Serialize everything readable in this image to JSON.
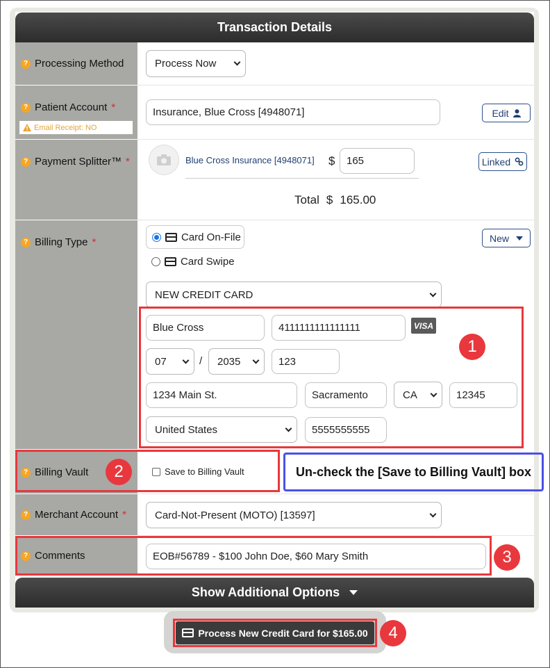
{
  "header": {
    "title": "Transaction Details"
  },
  "fields": {
    "processing_method": {
      "label": "Processing Method",
      "value": "Process Now"
    },
    "patient_account": {
      "label": "Patient Account",
      "value": "Insurance, Blue Cross [4948071]",
      "email_receipt": "Email Receipt: NO",
      "edit_label": "Edit"
    },
    "payment_splitter": {
      "label": "Payment Splitter™",
      "payer": "Blue Cross Insurance [4948071]",
      "currency": "$",
      "amount": "165",
      "linked_label": "Linked",
      "total_label": "Total",
      "total_currency": "$",
      "total_value": "165.00"
    },
    "billing_type": {
      "label": "Billing Type",
      "option_on_file": "Card On-File",
      "option_swipe": "Card Swipe",
      "selected": "Card On-File",
      "new_label": "New",
      "card_select": "NEW CREDIT CARD",
      "card": {
        "name": "Blue Cross",
        "number": "4111111111111111",
        "brand": "VISA",
        "exp_month": "07",
        "exp_separator": "/",
        "exp_year": "2035",
        "cvv": "123",
        "address": "1234 Main St.",
        "city": "Sacramento",
        "state": "CA",
        "zip": "12345",
        "country": "United States",
        "phone": "5555555555"
      }
    },
    "billing_vault": {
      "label": "Billing Vault",
      "checkbox_label": "Save to Billing Vault",
      "checked": false
    },
    "merchant_account": {
      "label": "Merchant Account",
      "value": "Card-Not-Present (MOTO) [13597]"
    },
    "comments": {
      "label": "Comments",
      "value": "EOB#56789 - $100 John Doe, $60 Mary Smith"
    }
  },
  "more_options": {
    "label": "Show Additional Options"
  },
  "submit": {
    "label": "Process New Credit Card for $165.00"
  },
  "annotations": {
    "step1": "1",
    "step2": "2",
    "step3": "3",
    "step4": "4",
    "callout": "Un-check the [Save to Billing Vault] box"
  },
  "colors": {
    "header": "#333333",
    "label_bg": "#a8a8a5",
    "annotation_red": "#e8383d",
    "annotation_blue": "#4a50e6",
    "link_blue": "#1f3f73",
    "required": "#d9292f"
  },
  "icons": [
    "help-icon",
    "warning-icon",
    "user-icon",
    "camera-avatar-icon",
    "link-icon",
    "credit-card-icon",
    "caret-down-icon"
  ],
  "req_mark": "*",
  "q_mark": "?"
}
